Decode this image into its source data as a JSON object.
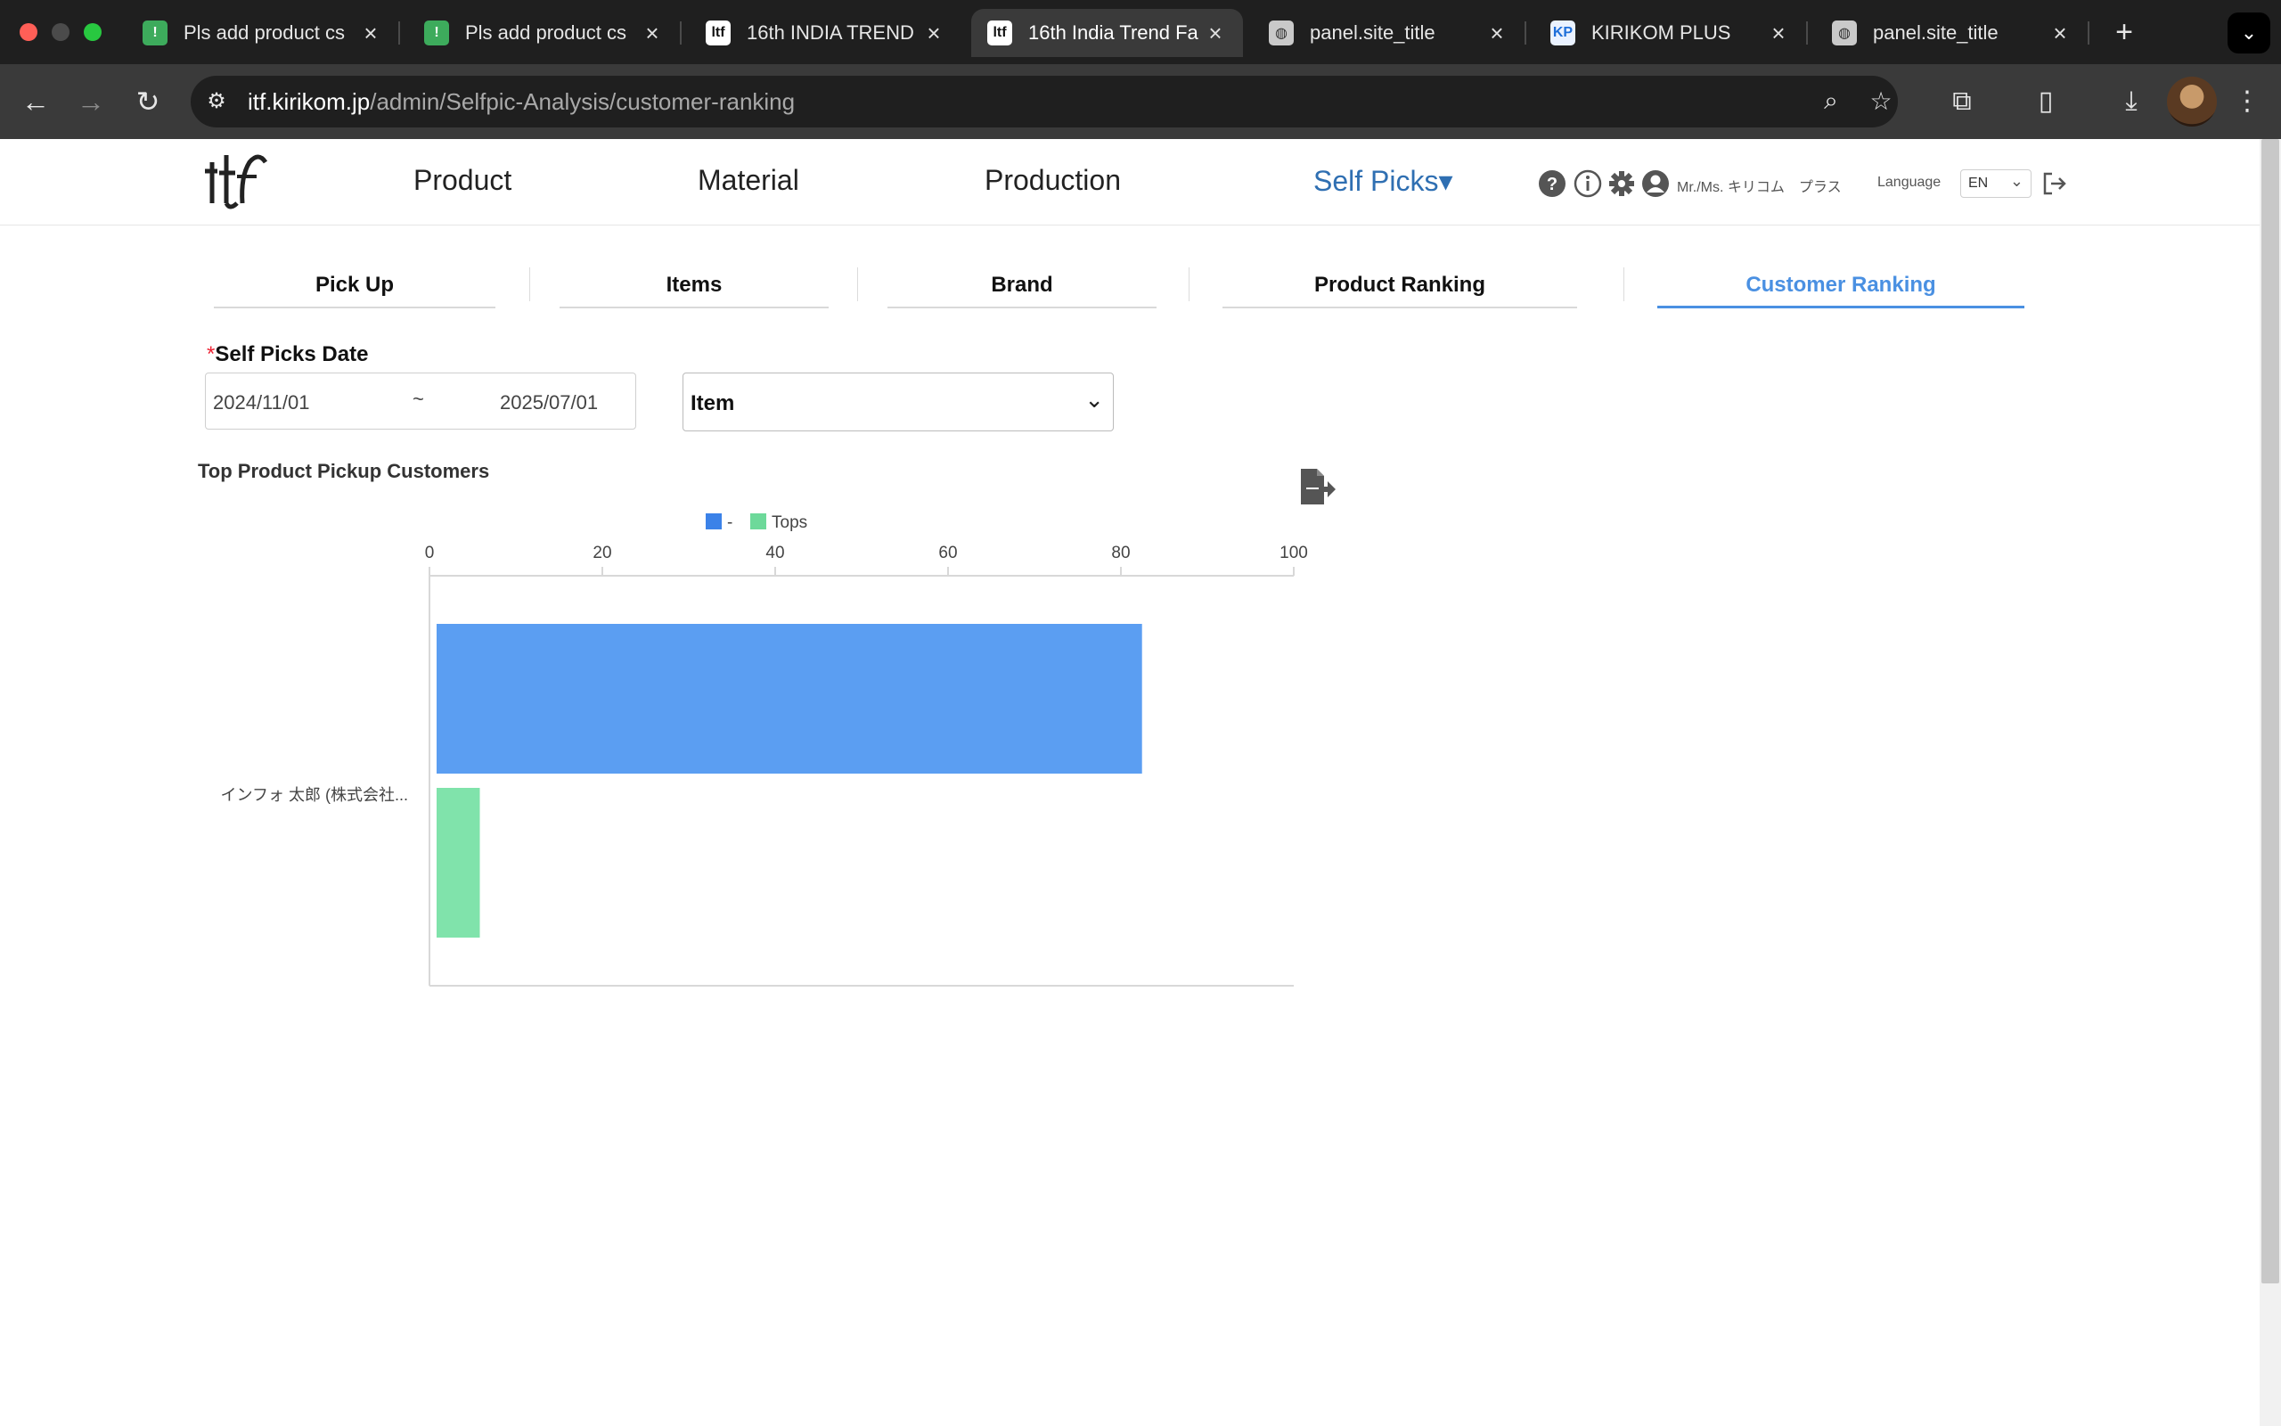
{
  "browser": {
    "tabs": [
      {
        "title": "Pls add product cs",
        "favicon": "green-app-icon",
        "active": false
      },
      {
        "title": "Pls add product cs",
        "favicon": "green-app-icon",
        "active": false
      },
      {
        "title": "16th INDIA TREND",
        "favicon": "itf-logo-icon",
        "active": false
      },
      {
        "title": "16th India Trend Fa",
        "favicon": "itf-logo-icon",
        "active": true
      },
      {
        "title": "panel.site_title",
        "favicon": "globe-icon",
        "active": false
      },
      {
        "title": "KIRIKOM PLUS",
        "favicon": "kirikom-icon",
        "active": false
      },
      {
        "title": "panel.site_title",
        "favicon": "globe-icon",
        "active": false
      }
    ],
    "url_domain": "itf.kirikom.jp",
    "url_path": "/admin/Selfpic-Analysis/customer-ranking"
  },
  "header": {
    "nav": [
      {
        "label": "Product",
        "active": false
      },
      {
        "label": "Material",
        "active": false
      },
      {
        "label": "Production",
        "active": false
      },
      {
        "label": "Self Picks▾",
        "active": true
      }
    ],
    "user_name": "Mr./Ms. キリコム　プラス",
    "language_label": "Language",
    "language_value": "EN",
    "accent_color": "#2f6fb2"
  },
  "subtabs": [
    {
      "label": "Pick Up",
      "active": false
    },
    {
      "label": "Items",
      "active": false
    },
    {
      "label": "Brand",
      "active": false
    },
    {
      "label": "Product Ranking",
      "active": false
    },
    {
      "label": "Customer Ranking",
      "active": true
    }
  ],
  "filters": {
    "date_label": "Self Picks Date",
    "required_mark": "*",
    "date_from": "2024/11/01",
    "date_separator": "~",
    "date_to": "2025/07/01",
    "item_select_value": "Item"
  },
  "chart_data": {
    "type": "bar",
    "orientation": "horizontal",
    "title": "Top Product Pickup Customers",
    "categories": [
      "インフォ 太郎 (株式会社..."
    ],
    "series": [
      {
        "name": "-",
        "values": [
          81
        ],
        "color": "#5b9ef2",
        "legend_color": "#3b82e8"
      },
      {
        "name": "Tops",
        "values": [
          5
        ],
        "color": "#80e3ab",
        "legend_color": "#6dd99a"
      }
    ],
    "xlim": [
      0,
      100
    ],
    "xticks": [
      0,
      20,
      40,
      60,
      80,
      100
    ],
    "x_axis_position": "top",
    "legend": "top-center",
    "grid": false
  }
}
